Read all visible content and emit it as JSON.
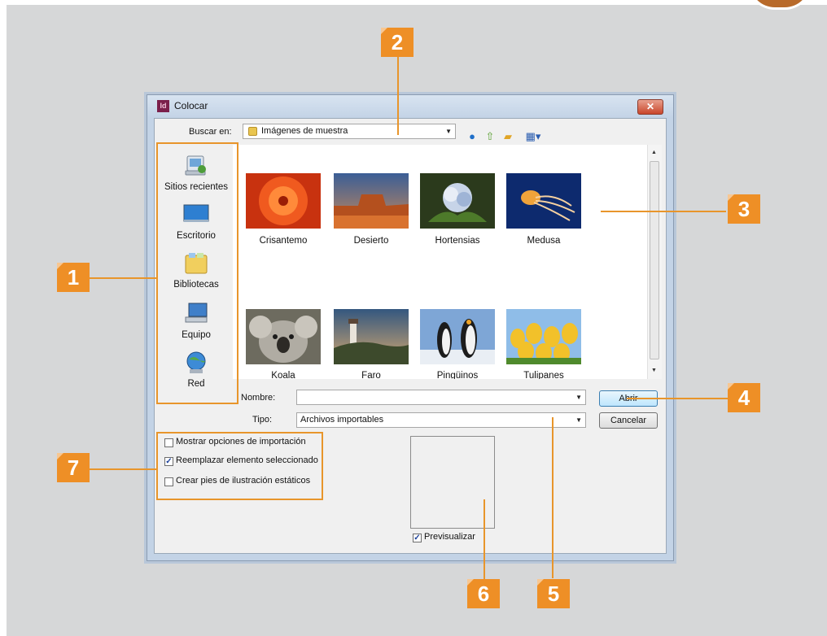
{
  "dialog": {
    "title": "Colocar",
    "app_icon": "Id",
    "close": "✕"
  },
  "lookin": {
    "label": "Buscar en:",
    "value": "Imágenes de muestra"
  },
  "toolbar_icons": [
    "back-icon",
    "up-folder-icon",
    "new-folder-icon",
    "view-menu-icon"
  ],
  "places": [
    {
      "label": "Sitios recientes",
      "icon": "recent-places-icon"
    },
    {
      "label": "Escritorio",
      "icon": "desktop-icon"
    },
    {
      "label": "Bibliotecas",
      "icon": "libraries-icon"
    },
    {
      "label": "Equipo",
      "icon": "computer-icon"
    },
    {
      "label": "Red",
      "icon": "network-icon"
    }
  ],
  "files": [
    {
      "name": "Crisantemo"
    },
    {
      "name": "Desierto"
    },
    {
      "name": "Hortensias"
    },
    {
      "name": "Medusa"
    },
    {
      "name": "Koala"
    },
    {
      "name": "Faro"
    },
    {
      "name": "Pingüinos"
    },
    {
      "name": "Tulipanes"
    }
  ],
  "filename": {
    "label": "Nombre:",
    "value": ""
  },
  "filetype": {
    "label": "Tipo:",
    "value": "Archivos importables"
  },
  "buttons": {
    "open": "Abrir",
    "cancel": "Cancelar"
  },
  "options": [
    {
      "label": "Mostrar opciones de importación",
      "checked": false
    },
    {
      "label": "Reemplazar elemento seleccionado",
      "checked": true
    },
    {
      "label": "Crear pies de ilustración estáticos",
      "checked": false
    }
  ],
  "preview": {
    "label": "Previsualizar",
    "checked": true
  },
  "callouts": [
    "1",
    "2",
    "3",
    "4",
    "5",
    "6",
    "7"
  ],
  "colors": {
    "accent": "#ee8f26",
    "background": "#d6d7d8",
    "dialog_frame": "#c3d3e6"
  }
}
